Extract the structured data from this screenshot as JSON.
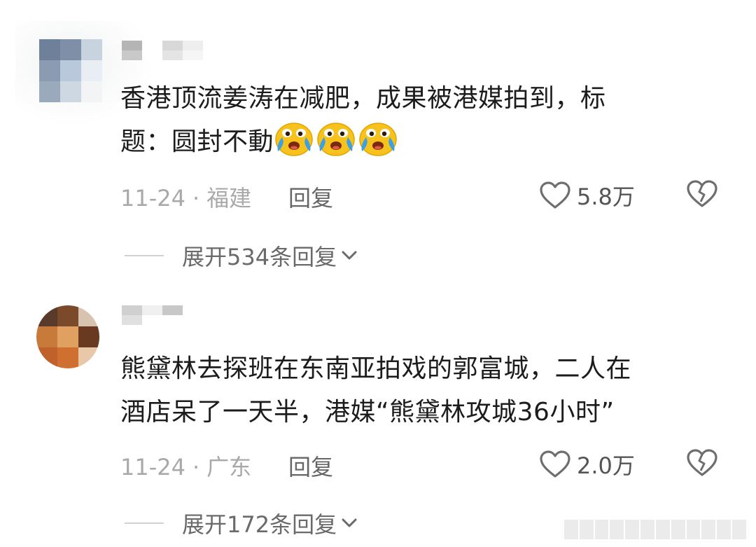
{
  "comments": [
    {
      "text_line1": "香港顶流姜涛在减肥，成果被港媒拍到，标",
      "text_line2": "题：圆封不動",
      "emoji_count": 3,
      "emoji_icon": "crying-face-icon",
      "date": "11-24",
      "location": "福建",
      "reply_label": "回复",
      "likes": "5.8万",
      "expand_label": "展开534条回复",
      "avatar_colors": [
        "#6f809a",
        "#7f8fa8",
        "#c8d3e0",
        "#8a9bb2",
        "#b9c8da",
        "#e8eef4",
        "#9aa9bb",
        "#cdd8e3",
        "#f2f4f6"
      ],
      "username_colors": [
        "#b5b5b5",
        "#ffffff",
        "#d8d8d8",
        "#eeeeee",
        "#ffffff",
        "#c9c9c9",
        "#ffffff",
        "#e4e4e4",
        "#f5f5f5",
        "#ffffff"
      ]
    },
    {
      "text_line1": "熊黛林去探班在东南亚拍戏的郭富城，二人在",
      "text_line2": "酒店呆了一天半，港媒“熊黛林攻城36小时”",
      "date": "11-24",
      "location": "广东",
      "reply_label": "回复",
      "likes": "2.0万",
      "expand_label": "展开172条回复",
      "avatar_colors": [
        "#5a3a2a",
        "#7a4a2a",
        "#d8c2b0",
        "#c87a3a",
        "#e0a060",
        "#6a3a20",
        "#c0602a",
        "#d07030",
        "#e8c8a8"
      ],
      "username_colors": [
        "#d0d0d0",
        "#f0f0f0",
        "#c8c8c8",
        "#ffffff",
        "#ffffff",
        "#e0e0e0",
        "#ffffff",
        "#ffffff",
        "#ffffff",
        "#ffffff"
      ]
    }
  ],
  "icons": {
    "like": "heart-outline-icon",
    "dislike": "broken-heart-icon",
    "expand": "chevron-down-icon"
  },
  "colors": {
    "text": "#1c1c1c",
    "meta": "#a9a9a9",
    "secondary": "#666666",
    "icon": "#6e6e6e"
  }
}
